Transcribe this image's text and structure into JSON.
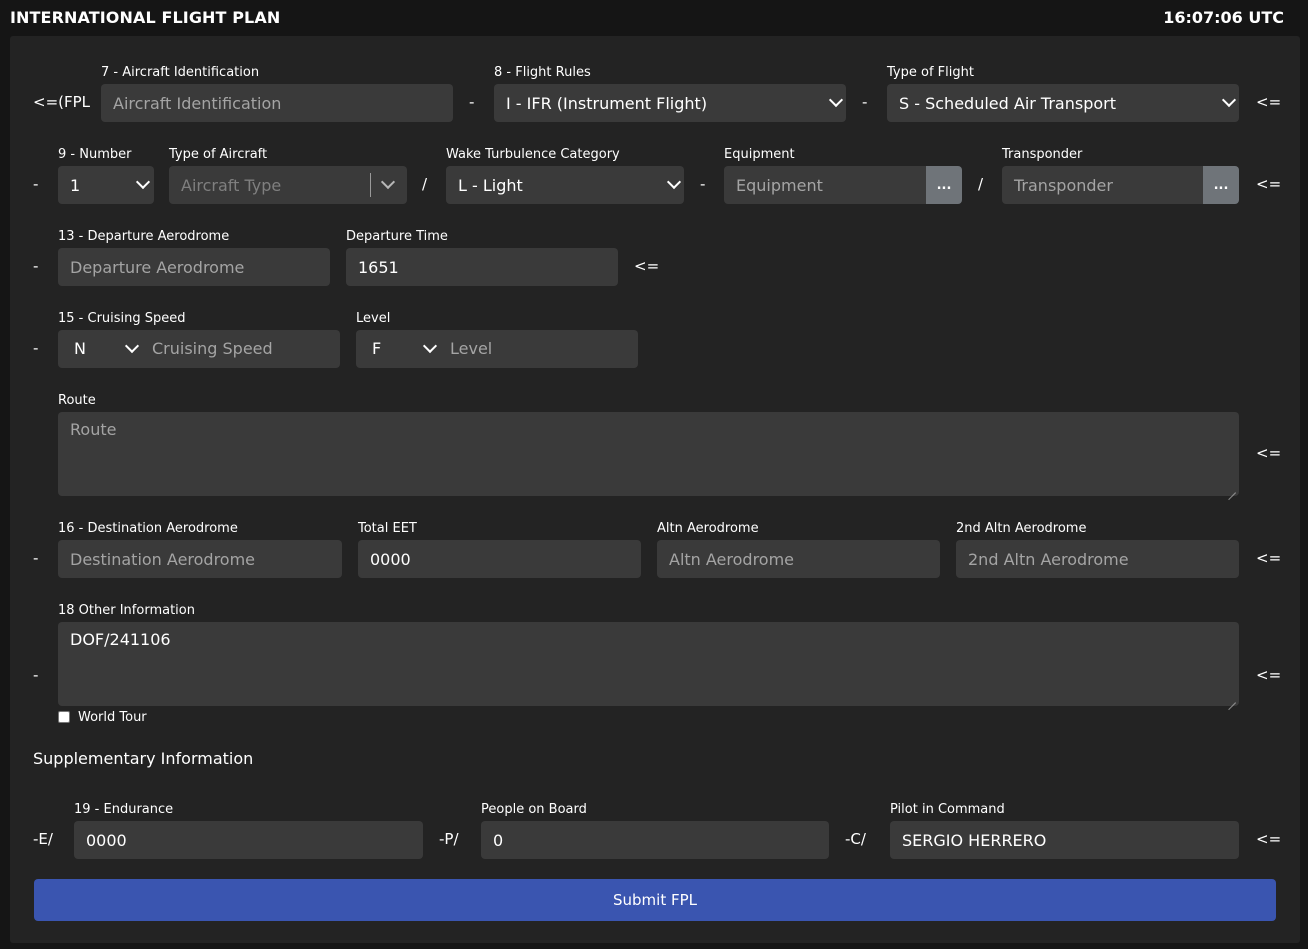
{
  "header": {
    "title": "INTERNATIONAL FLIGHT PLAN",
    "clock": "16:07:06 UTC"
  },
  "row7": {
    "prefix": "<=(FPL",
    "aircraft_id_label": "7 - Aircraft Identification",
    "aircraft_id_placeholder": "Aircraft Identification",
    "dash1": "-",
    "flight_rules_label": "8 - Flight Rules",
    "flight_rules_value": "I - IFR (Instrument Flight)",
    "dash2": "-",
    "type_of_flight_label": "Type of Flight",
    "type_of_flight_value": "S - Scheduled Air Transport",
    "end": "<="
  },
  "row9": {
    "dash": "-",
    "number_label": "9 - Number",
    "number_value": "1",
    "aircraft_type_label": "Type of Aircraft",
    "aircraft_type_placeholder": "Aircraft Type",
    "slash1": "/",
    "wake_label": "Wake Turbulence Category",
    "wake_value": "L - Light",
    "dash2": "-",
    "equipment_label": "Equipment",
    "equipment_placeholder": "Equipment",
    "equipment_btn": "...",
    "slash2": "/",
    "transponder_label": "Transponder",
    "transponder_placeholder": "Transponder",
    "transponder_btn": "...",
    "end": "<="
  },
  "row13": {
    "dash": "-",
    "departure_label": "13 - Departure Aerodrome",
    "departure_placeholder": "Departure Aerodrome",
    "time_label": "Departure Time",
    "time_value": "1651",
    "end": "<="
  },
  "row15": {
    "dash": "-",
    "speed_label": "15 - Cruising Speed",
    "speed_unit": "N",
    "speed_placeholder": "Cruising Speed",
    "level_label": "Level",
    "level_unit": "F",
    "level_placeholder": "Level"
  },
  "route": {
    "label": "Route",
    "placeholder": "Route",
    "end": "<="
  },
  "row16": {
    "dash": "-",
    "destination_label": "16 - Destination Aerodrome",
    "destination_placeholder": "Destination Aerodrome",
    "eet_label": "Total EET",
    "eet_value": "0000",
    "altn_label": "Altn Aerodrome",
    "altn_placeholder": "Altn Aerodrome",
    "altn2_label": "2nd Altn Aerodrome",
    "altn2_placeholder": "2nd Altn Aerodrome",
    "end": "<="
  },
  "row18": {
    "dash": "-",
    "label": "18 Other Information",
    "value": "DOF/241106",
    "end": "<=",
    "world_tour_label": "World Tour"
  },
  "supplementary": {
    "title": "Supplementary Information",
    "e_prefix": "-E/",
    "endurance_label": "19 - Endurance",
    "endurance_value": "0000",
    "p_prefix": "-P/",
    "pob_label": "People on Board",
    "pob_value": "0",
    "c_prefix": "-C/",
    "pic_label": "Pilot in Command",
    "pic_value": "SERGIO HERRERO",
    "end": "<="
  },
  "submit_label": "Submit FPL"
}
